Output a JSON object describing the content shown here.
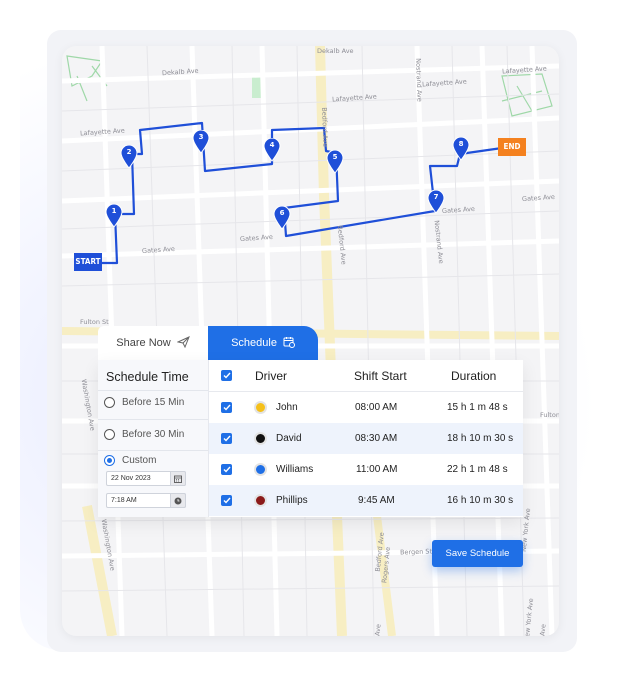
{
  "tabs": {
    "share_now": "Share Now",
    "schedule": "Schedule"
  },
  "schedule_time": {
    "title": "Schedule Time",
    "options": [
      {
        "label": "Before 15 Min",
        "selected": false
      },
      {
        "label": "Before 30 Min",
        "selected": false
      },
      {
        "label": "Custom",
        "selected": true
      }
    ],
    "date_value": "22 Nov 2023",
    "time_value": "7:18 AM"
  },
  "table": {
    "headers": {
      "driver": "Driver",
      "shift_start": "Shift Start",
      "duration": "Duration"
    },
    "rows": [
      {
        "driver": "John",
        "shift_start": "08:00 AM",
        "duration": "15 h 1 m 48 s",
        "color": "#f5c01a",
        "checked": true
      },
      {
        "driver": "David",
        "shift_start": "08:30 AM",
        "duration": "18 h 10 m 30 s",
        "color": "#111111",
        "checked": true
      },
      {
        "driver": "Williams",
        "shift_start": "11:00 AM",
        "duration": "22 h 1 m 48 s",
        "color": "#1f6fe6",
        "checked": true
      },
      {
        "driver": "Phillips",
        "shift_start": "9:45 AM",
        "duration": "16 h 10 m 30 s",
        "color": "#8b1a1a",
        "checked": true
      }
    ]
  },
  "save_button": "Save Schedule",
  "map": {
    "start_label": "START",
    "end_label": "END",
    "stops": [
      "1",
      "2",
      "3",
      "4",
      "5",
      "6",
      "7",
      "8"
    ],
    "streets": [
      "Dekalb Ave",
      "Dekalb Ave",
      "Lafayette Ave",
      "Lafayette Ave",
      "Lafayette Ave",
      "Lafayette Ave",
      "Gates Ave",
      "Gates Ave",
      "Gates Ave",
      "Gates Ave",
      "Fulton St",
      "Fulton",
      "Bedford Ave",
      "Bedford Ave",
      "Bedford Ave",
      "Nostrand Ave",
      "Nostrand Ave",
      "Washington Ave",
      "Washington Ave",
      "Bergen St",
      "Rogers Ave",
      "New York Ave",
      "New York Ave",
      "Ave",
      "Ave"
    ],
    "route_color": "#1f4fd8",
    "end_color": "#f4811f"
  }
}
